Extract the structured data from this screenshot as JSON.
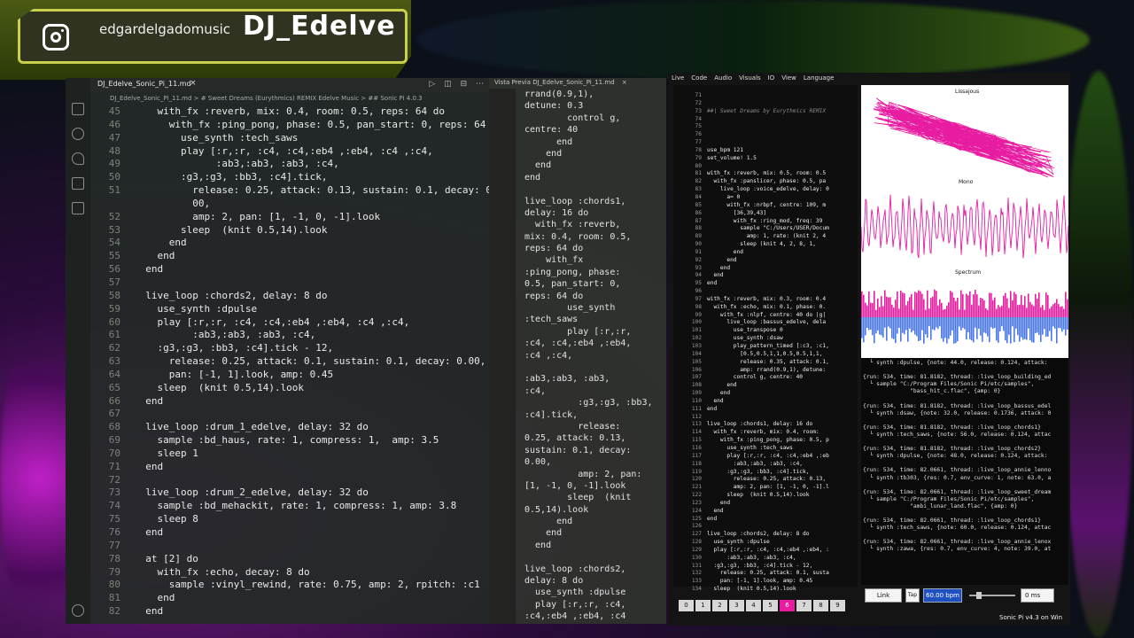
{
  "banner": {
    "handle": "edgardelgadomusic",
    "title": "DJ_Edelve"
  },
  "editor": {
    "tab_label": "DJ_Edelve_Sonic_Pi_11.md",
    "tab_close": "×",
    "breadcrumb": "DJ_Edelve_Sonic_Pi_11.md > # Sweet Dreams (Eurythmics) REMIX Edelve Music > ## Sonic Pi 4.0.3",
    "lines": [
      {
        "n": "45",
        "t": "    with_fx :reverb, mix: 0.4, room: 0.5, reps: 64 do"
      },
      {
        "n": "46",
        "t": "      with_fx :ping_pong, phase: 0.5, pan_start: 0, reps: 64 do"
      },
      {
        "n": "47",
        "t": "        use_synth :tech_saws"
      },
      {
        "n": "48",
        "t": "        play [:r,:r, :c4, :c4,:eb4 ,:eb4, :c4 ,:c4,"
      },
      {
        "n": "49",
        "t": "              :ab3,:ab3, :ab3, :c4,"
      },
      {
        "n": "50",
        "t": "        :g3,:g3, :bb3, :c4].tick,"
      },
      {
        "n": "51",
        "t": "          release: 0.25, attack: 0.13, sustain: 0.1, decay: 0."
      },
      {
        "n": "",
        "t": "          00,"
      },
      {
        "n": "52",
        "t": "          amp: 2, pan: [1, -1, 0, -1].look"
      },
      {
        "n": "53",
        "t": "        sleep  (knit 0.5,14).look"
      },
      {
        "n": "54",
        "t": "      end"
      },
      {
        "n": "55",
        "t": "    end"
      },
      {
        "n": "56",
        "t": "  end"
      },
      {
        "n": "57",
        "t": ""
      },
      {
        "n": "58",
        "t": "  live_loop :chords2, delay: 8 do"
      },
      {
        "n": "59",
        "t": "    use_synth :dpulse"
      },
      {
        "n": "60",
        "t": "    play [:r,:r, :c4, :c4,:eb4 ,:eb4, :c4 ,:c4,"
      },
      {
        "n": "61",
        "t": "          :ab3,:ab3, :ab3, :c4,"
      },
      {
        "n": "62",
        "t": "    :g3,:g3, :bb3, :c4].tick - 12,"
      },
      {
        "n": "63",
        "t": "      release: 0.25, attack: 0.1, sustain: 0.1, decay: 0.00,"
      },
      {
        "n": "64",
        "t": "      pan: [-1, 1].look, amp: 0.45"
      },
      {
        "n": "65",
        "t": "    sleep  (knit 0.5,14).look"
      },
      {
        "n": "66",
        "t": "  end"
      },
      {
        "n": "67",
        "t": ""
      },
      {
        "n": "68",
        "t": "  live_loop :drum_1_edelve, delay: 32 do"
      },
      {
        "n": "69",
        "t": "    sample :bd_haus, rate: 1, compress: 1,  amp: 3.5"
      },
      {
        "n": "70",
        "t": "    sleep 1"
      },
      {
        "n": "71",
        "t": "  end"
      },
      {
        "n": "72",
        "t": ""
      },
      {
        "n": "73",
        "t": "  live_loop :drum_2_edelve, delay: 32 do"
      },
      {
        "n": "74",
        "t": "    sample :bd_mehackit, rate: 1, compress: 1, amp: 3.8"
      },
      {
        "n": "75",
        "t": "    sleep 8"
      },
      {
        "n": "76",
        "t": "  end"
      },
      {
        "n": "77",
        "t": ""
      },
      {
        "n": "78",
        "t": "  at [2] do"
      },
      {
        "n": "79",
        "t": "    with_fx :echo, decay: 8 do"
      },
      {
        "n": "80",
        "t": "      sample :vinyl_rewind, rate: 0.75, amp: 2, rpitch: :c1"
      },
      {
        "n": "81",
        "t": "    end"
      },
      {
        "n": "82",
        "t": "  end"
      }
    ]
  },
  "preview": {
    "tab_label": "Vista Previa DJ_Edelve_Sonic_Pi_11.md",
    "tab_close": "×",
    "lines": [
      "rrand(0.9,1),",
      "detune: 0.3",
      "        control g,",
      "centre: 40",
      "      end",
      "    end",
      "  end",
      "end",
      "",
      "live_loop :chords1,",
      "delay: 16 do",
      "  with_fx :reverb,",
      "mix: 0.4, room: 0.5,",
      "reps: 64 do",
      "    with_fx",
      ":ping_pong, phase:",
      "0.5, pan_start: 0,",
      "reps: 64 do",
      "        use_synth",
      ":tech_saws",
      "        play [:r,:r,",
      ":c4, :c4,:eb4 ,:eb4,",
      ":c4 ,:c4,",
      "",
      ":ab3,:ab3, :ab3,",
      ":c4,",
      "          :g3,:g3, :bb3,",
      ":c4].tick,",
      "          release:",
      "0.25, attack: 0.13,",
      "sustain: 0.1, decay:",
      "0.00,",
      "          amp: 2, pan:",
      "[1, -1, 0, -1].look",
      "        sleep  (knit",
      "0.5,14).look",
      "      end",
      "    end",
      "  end",
      "",
      "live_loop :chords2,",
      "delay: 8 do",
      "  use_synth :dpulse",
      "  play [:r,:r, :c4,",
      ":c4,:eb4 ,:eb4, :c4"
    ]
  },
  "sonicpi": {
    "menu": [
      "Live",
      "Code",
      "Audio",
      "Visuals",
      "IO",
      "View",
      "Language"
    ],
    "code": [
      {
        "n": "71",
        "t": ""
      },
      {
        "n": "72",
        "t": ""
      },
      {
        "n": "73",
        "t": "##| Sweet Dreams by Eurythmics REMIX",
        "c": true
      },
      {
        "n": "74",
        "t": ""
      },
      {
        "n": "75",
        "t": ""
      },
      {
        "n": "76",
        "t": ""
      },
      {
        "n": "77",
        "t": ""
      },
      {
        "n": "78",
        "t": "use_bpm 121"
      },
      {
        "n": "79",
        "t": "set_volume! 1.5"
      },
      {
        "n": "80",
        "t": ""
      },
      {
        "n": "81",
        "t": "with_fx :reverb, mix: 0.5, room: 0.5"
      },
      {
        "n": "82",
        "t": "  with_fx :panslicer, phase: 0.5, pa"
      },
      {
        "n": "83",
        "t": "    live_loop :voice_edelve, delay: 0"
      },
      {
        "n": "84",
        "t": "      a= 0"
      },
      {
        "n": "85",
        "t": "      with_fx :nrbpf, centre: 109, m"
      },
      {
        "n": "86",
        "t": "        [36,39,43]"
      },
      {
        "n": "87",
        "t": "        with_fx :ring_mod, freq: 39"
      },
      {
        "n": "88",
        "t": "          sample \"C:/Users/USER/Docum"
      },
      {
        "n": "89",
        "t": "            amp: 1, rate: (knit 2, 4"
      },
      {
        "n": "90",
        "t": "          sleep (knit 4, 2, 8, 1,"
      },
      {
        "n": "91",
        "t": "        end"
      },
      {
        "n": "92",
        "t": "      end"
      },
      {
        "n": "93",
        "t": "    end"
      },
      {
        "n": "94",
        "t": "  end"
      },
      {
        "n": "95",
        "t": "end"
      },
      {
        "n": "96",
        "t": ""
      },
      {
        "n": "97",
        "t": "with_fx :reverb, mix: 0.3, room: 0.4"
      },
      {
        "n": "98",
        "t": "  with_fx :echo, mix: 0.1, phase: 0."
      },
      {
        "n": "99",
        "t": "    with_fx :nlpf, centre: 40 do |g|"
      },
      {
        "n": "100",
        "t": "      live_loop :bassus_edelve, dela"
      },
      {
        "n": "101",
        "t": "        use_transpose 0"
      },
      {
        "n": "102",
        "t": "        use_synth :dsaw"
      },
      {
        "n": "103",
        "t": "        play_pattern_timed [:c3, :c1,"
      },
      {
        "n": "104",
        "t": "          [0.5,0.5,1,1,0.5,0.5,1,1,"
      },
      {
        "n": "105",
        "t": "          release: 0.35, attack: 0.1,"
      },
      {
        "n": "106",
        "t": "          amp: rrand(0.9,1), detune:"
      },
      {
        "n": "107",
        "t": "        control g, centre: 40"
      },
      {
        "n": "108",
        "t": "      end"
      },
      {
        "n": "109",
        "t": "    end"
      },
      {
        "n": "110",
        "t": "  end"
      },
      {
        "n": "111",
        "t": "end"
      },
      {
        "n": "112",
        "t": ""
      },
      {
        "n": "113",
        "t": "live_loop :chords1, delay: 16 do"
      },
      {
        "n": "114",
        "t": "  with_fx :reverb, mix: 0.4, room:"
      },
      {
        "n": "115",
        "t": "    with_fx :ping_pong, phase: 0.5, p"
      },
      {
        "n": "116",
        "t": "      use_synth :tech_saws"
      },
      {
        "n": "117",
        "t": "      play [:r,:r, :c4, :c4,:eb4 ,:eb"
      },
      {
        "n": "118",
        "t": "        :ab3,:ab3, :ab3, :c4,"
      },
      {
        "n": "119",
        "t": "      :g3,:g3, :bb3, :c4].tick,"
      },
      {
        "n": "120",
        "t": "        release: 0.25, attack: 0.13,"
      },
      {
        "n": "121",
        "t": "        amp: 2, pan: [1, -1, 0, -1].l"
      },
      {
        "n": "122",
        "t": "      sleep  (knit 0.5,14).look"
      },
      {
        "n": "123",
        "t": "    end"
      },
      {
        "n": "124",
        "t": "  end"
      },
      {
        "n": "125",
        "t": "end"
      },
      {
        "n": "126",
        "t": ""
      },
      {
        "n": "127",
        "t": "live_loop :chords2, delay: 8 do"
      },
      {
        "n": "128",
        "t": "  use_synth :dpulse"
      },
      {
        "n": "129",
        "t": "  play [:r,:r, :c4, :c4,:eb4 ,:eb4, :"
      },
      {
        "n": "130",
        "t": "      :ab3,:ab3, :ab3, :c4,"
      },
      {
        "n": "131",
        "t": "  :g3,:g3, :bb3, :c4].tick - 12,"
      },
      {
        "n": "132",
        "t": "    release: 0.25, attack: 0.1, susta"
      },
      {
        "n": "133",
        "t": "    pan: [-1, 1].look, amp: 0.45"
      },
      {
        "n": "134",
        "t": "  sleep  (knit 0.5,14).look"
      }
    ],
    "buffers": [
      "0",
      "1",
      "2",
      "3",
      "4",
      "5",
      "6",
      "7",
      "8",
      "9"
    ],
    "active_buffer": 6,
    "scope_labels": [
      "Lissajous",
      "Mono",
      "Spectrum"
    ],
    "log": [
      "  └ synth :dpulse, {note: 44.0, release: 0.124, attack:",
      "",
      "{run: 534, time: 81.8182, thread: :live_loop_building_ed",
      "  └ sample \"C:/Program Files/Sonic Pi/etc/samples\",",
      "              \"bass_hit_c.flac\", {amp: 0}",
      "",
      "{run: 534, time: 81.8182, thread: :live_loop_bassus_edel",
      "  └ synth :dsaw, {note: 32.0, release: 0.1736, attack: 0",
      "",
      "{run: 534, time: 81.8182, thread: :live_loop_chords1}",
      "  └ synth :tech_saws, {note: 56.0, release: 0.124, attac",
      "",
      "{run: 534, time: 81.8182, thread: :live_loop_chords2}",
      "  └ synth :dpulse, {note: 48.0, release: 0.124, attack:",
      "",
      "{run: 534, time: 82.0661, thread: :live_loop_annie_lenno",
      "  └ synth :tb303, {res: 0.7, env_curve: 1, note: 63.0, a",
      "",
      "{run: 534, time: 82.0661, thread: :live_loop_sweet_dream",
      "  └ sample \"C:/Program Files/Sonic Pi/etc/samples\",",
      "              \"ambi_lunar_land.flac\", {amp: 0}",
      "",
      "{run: 534, time: 82.0661, thread: :live_loop_chords1}",
      "  └ synth :tech_saws, {note: 60.0, release: 0.124, attac",
      "",
      "{run: 534, time: 82.0661, thread: :live_loop_annie_lenox",
      "  └ synth :zawa, {res: 0.7, env_curve: 4, note: 39.0, at"
    ],
    "link_label": "Link",
    "tap_label": "Tap",
    "bpm_value": "60.00 bpm",
    "latency_value": "0 ms",
    "status": "Sonic Pi v4.3 on Win",
    "colors": {
      "accent": "#e81ca0",
      "spectrum_low": "#4a78e8"
    }
  }
}
